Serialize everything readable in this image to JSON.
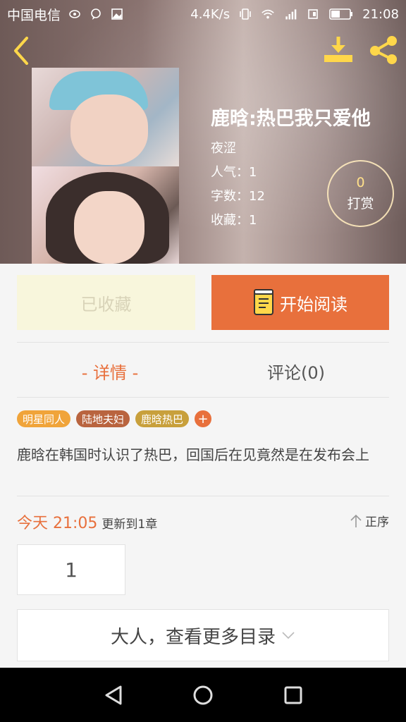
{
  "status_bar": {
    "carrier": "中国电信",
    "speed": "4.4K/s",
    "time": "21:08",
    "icons": [
      "eye-icon",
      "chat-icon",
      "image-icon",
      "vibrate-icon",
      "wifi-icon",
      "signal-icon",
      "sim-icon",
      "battery-icon"
    ]
  },
  "book": {
    "title": "鹿晗:热巴我只爱他",
    "author": "夜涩",
    "popularity": "人气：1",
    "word_count": "字数：12",
    "favorites": "收藏：1"
  },
  "tip": {
    "count": "0",
    "label": "打赏"
  },
  "actions": {
    "collected_label": "已收藏",
    "read_label": "开始阅读"
  },
  "tabs": {
    "detail": "- 详情 -",
    "comments": "评论(0)"
  },
  "tags": [
    {
      "label": "明星同人",
      "color": "#f0a43a"
    },
    {
      "label": "陆地夫妇",
      "color": "#b9643f"
    },
    {
      "label": "鹿晗热巴",
      "color": "#c8a03c"
    }
  ],
  "add_tag_symbol": "+",
  "description": "鹿晗在韩国时认识了热巴，回国后在见竟然是在发布会上",
  "update": {
    "day_time": "今天 21:05",
    "text": "更新到1章",
    "order": "正序"
  },
  "chapter_number": "1",
  "more_catalog": "大人，查看更多目录",
  "colors": {
    "accent": "#e8703c",
    "tip_count": "#ffe08a"
  }
}
